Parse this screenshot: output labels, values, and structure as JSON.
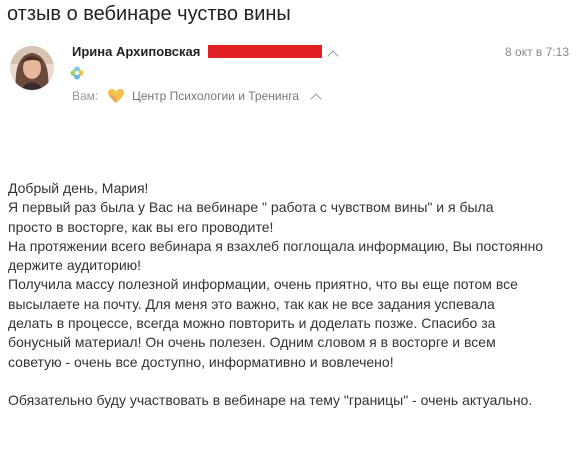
{
  "email": {
    "subject": "отзыв о вебинаре чуство вины",
    "sender_name": "Ирина Архиповская",
    "date": "8 окт в 7:13",
    "to_label": "Вам:",
    "recipient": "Центр Психологии и Тренинга",
    "body_lines": [
      "Добрый день, Мария!",
      "Я первый раз была у Вас на вебинаре \" работа с чувством вины\" и я была",
      "просто в восторге, как вы его проводите!",
      "На протяжении всего вебинара я взахлеб поглощала информацию, Вы постоянно",
      "держите аудиторию!",
      "Получила массу полезной информации, очень приятно, что вы еще потом все",
      "высылаете на почту. Для меня это важно, так как не все задания успевала",
      "делать в процессе, всегда можно повторить и доделать позже. Спасибо за",
      "бонусный материал! Он очень полезен. Одним словом я в восторге и всем",
      "советую - очень все доступно, информативно и вовлечено!",
      "Обязательно буду участвовать в вебинаре на тему \"границы\" - очень актуально."
    ]
  },
  "colors": {
    "redaction": "#e02020",
    "heart_logo": "#f2c14e",
    "flower": "#6bb7e8"
  },
  "icons": {
    "avatar": "sender-avatar-photo",
    "status": "flower-status-icon",
    "recipient_logo": "heart-logo-icon",
    "expand": "chevron-up-icon"
  }
}
